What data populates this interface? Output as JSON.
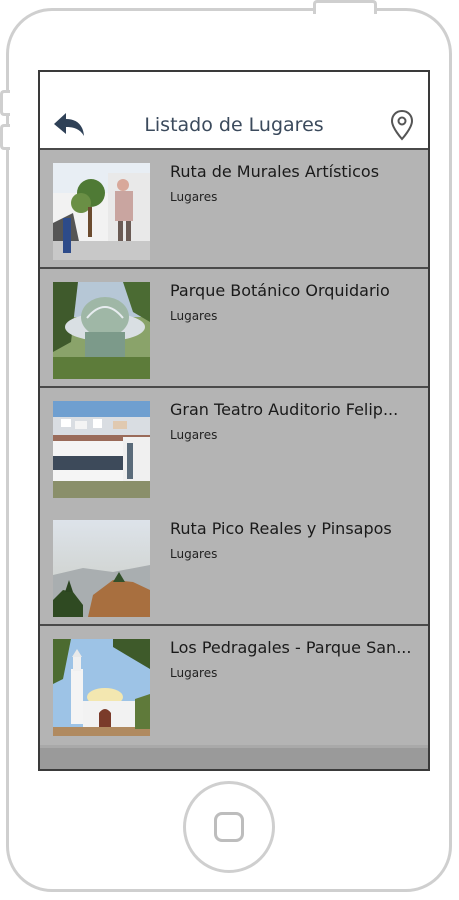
{
  "header": {
    "title": "Listado de Lugares",
    "back_icon": "back-arrow-icon",
    "map_icon": "map-pin-icon"
  },
  "places": [
    {
      "title": "Ruta de Murales Artísticos",
      "category": "Lugares",
      "thumb": "murals-photo"
    },
    {
      "title": "Parque Botánico Orquidario",
      "category": "Lugares",
      "thumb": "orchid-dome-photo"
    },
    {
      "title": "Gran Teatro Auditorio Felip...",
      "category": "Lugares",
      "thumb": "theatre-town-photo"
    },
    {
      "title": "Ruta Pico Reales y Pinsapos",
      "category": "Lugares",
      "thumb": "mountain-view-photo"
    },
    {
      "title": "Los Pedragales - Parque San...",
      "category": "Lugares",
      "thumb": "chapel-photo"
    }
  ],
  "colors": {
    "list_bg": "#b4b4b4",
    "header_text": "#3b4a5c",
    "back_icon": "#2f4157"
  }
}
